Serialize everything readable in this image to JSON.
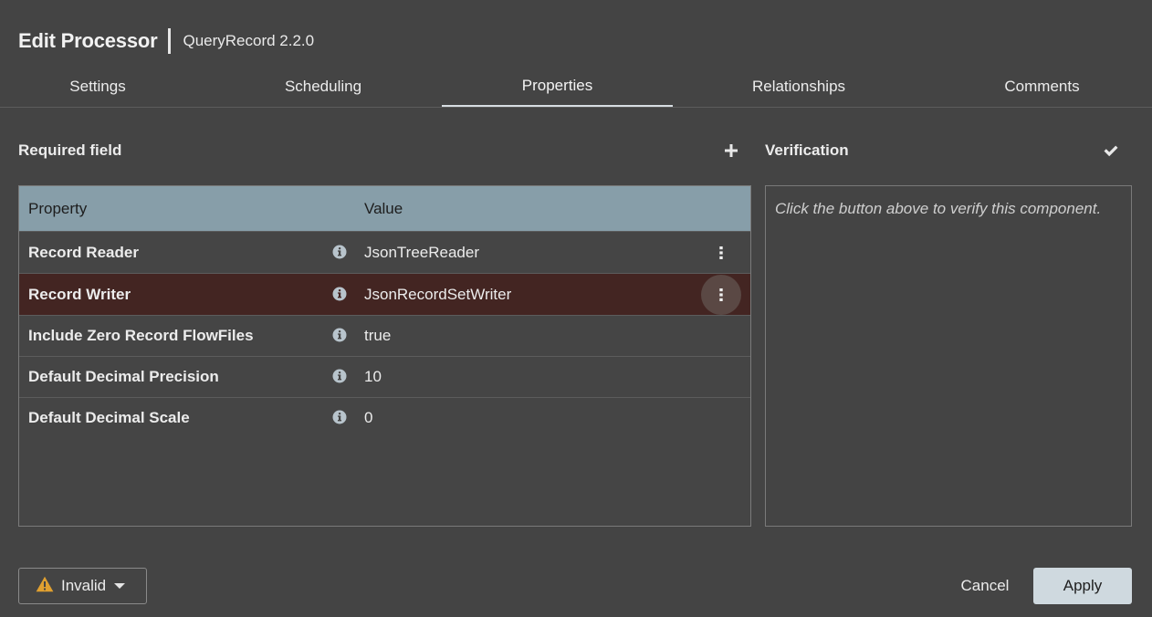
{
  "header": {
    "title": "Edit Processor",
    "subtitle": "QueryRecord 2.2.0"
  },
  "tabs": [
    {
      "label": "Settings",
      "active": false
    },
    {
      "label": "Scheduling",
      "active": false
    },
    {
      "label": "Properties",
      "active": true
    },
    {
      "label": "Relationships",
      "active": false
    },
    {
      "label": "Comments",
      "active": false
    }
  ],
  "properties": {
    "section_label": "Required field",
    "add_icon": "plus-icon",
    "columns": {
      "property": "Property",
      "value": "Value"
    },
    "rows": [
      {
        "name": "Record Reader",
        "value": "JsonTreeReader",
        "has_menu": true,
        "selected": false
      },
      {
        "name": "Record Writer",
        "value": "JsonRecordSetWriter",
        "has_menu": true,
        "selected": true
      },
      {
        "name": "Include Zero Record FlowFiles",
        "value": "true",
        "has_menu": false,
        "selected": false
      },
      {
        "name": "Default Decimal Precision",
        "value": "10",
        "has_menu": false,
        "selected": false
      },
      {
        "name": "Default Decimal Scale",
        "value": "0",
        "has_menu": false,
        "selected": false
      }
    ]
  },
  "verification": {
    "label": "Verification",
    "icon": "check-icon",
    "placeholder": "Click the button above to verify this component."
  },
  "footer": {
    "status_label": "Invalid",
    "status_icon": "warning-icon",
    "cancel_label": "Cancel",
    "apply_label": "Apply"
  },
  "colors": {
    "background": "#444444",
    "header_row": "#879ea9",
    "selected_row": "#432522",
    "warning": "#e0a030",
    "apply_button": "#cfd9df"
  }
}
